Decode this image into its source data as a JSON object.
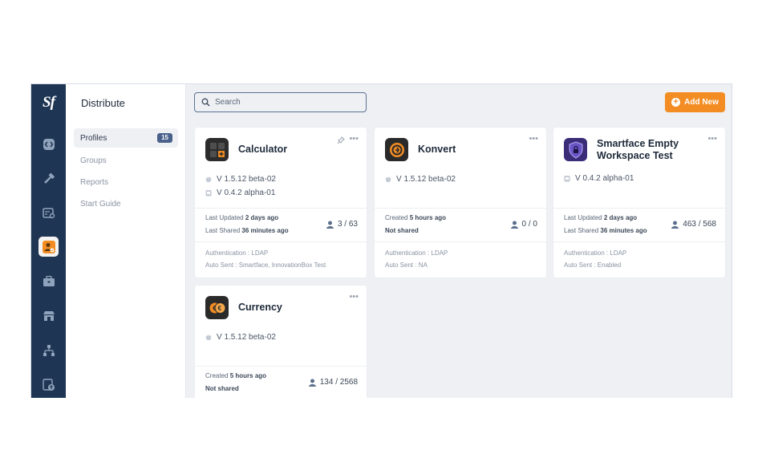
{
  "app": {
    "logo": "Sf",
    "section_title": "Distribute"
  },
  "rail": {
    "icons": [
      "code-icon",
      "hammer-icon",
      "test-icon",
      "distribute-icon",
      "briefcase-icon",
      "store-icon",
      "hierarchy-icon",
      "upload-icon"
    ],
    "active": "distribute-icon",
    "active_color": "#f38d23"
  },
  "subnav": {
    "items": [
      {
        "label": "Profiles",
        "badge": "15"
      },
      {
        "label": "Groups"
      },
      {
        "label": "Reports"
      },
      {
        "label": "Start Guide"
      }
    ]
  },
  "toolbar": {
    "search_placeholder": "Search",
    "add_label": "Add New",
    "accent": "#f38d23"
  },
  "cards": [
    {
      "name": "Calculator",
      "versions": [
        {
          "os": "apple",
          "label": "V 1.5.12 beta-02"
        },
        {
          "os": "android",
          "label": "V 0.4.2 alpha-01"
        }
      ],
      "updated_prefix": "Last Updated",
      "updated_value": "2 days ago",
      "shared_prefix": "Last Shared",
      "shared_value": "36 minutes ago",
      "share_count": "3 / 63",
      "auth": "Authentication : LDAP",
      "auto_sent": "Auto Sent : Smartface, InnovationBox Test"
    },
    {
      "name": "Konvert",
      "versions": [
        {
          "os": "apple",
          "label": "V 1.5.12 beta-02"
        }
      ],
      "updated_prefix": "Created",
      "updated_value": "5 hours ago",
      "shared_prefix": "",
      "shared_value": "Not shared",
      "share_count": "0 / 0",
      "auth": "Authentication : LDAP",
      "auto_sent": "Auto Sent : NA"
    },
    {
      "name_line1": "Smartface Empty",
      "name_line2": "Workspace Test",
      "versions": [
        {
          "os": "android",
          "label": "V 0.4.2 alpha-01"
        }
      ],
      "updated_prefix": "Last Updated",
      "updated_value": "2 days ago",
      "shared_prefix": "Last Shared",
      "shared_value": "36 minutes ago",
      "share_count": "463 / 568",
      "auth": "Authentication : LDAP",
      "auto_sent": "Auto Sent : Enabled"
    },
    {
      "name": "Currency",
      "versions": [
        {
          "os": "apple",
          "label": "V 1.5.12 beta-02"
        }
      ],
      "updated_prefix": "Created",
      "updated_value": "5 hours ago",
      "shared_prefix": "",
      "shared_value": "Not shared",
      "share_count": "134 / 2568"
    }
  ]
}
